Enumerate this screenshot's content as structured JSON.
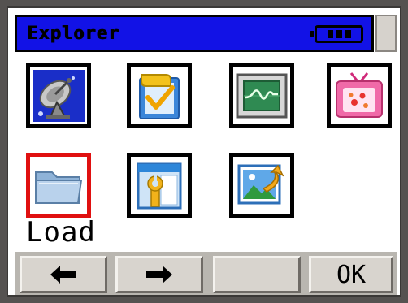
{
  "window": {
    "title": "Explorer"
  },
  "status": {
    "battery_icon": "battery-icon"
  },
  "grid": {
    "items": [
      {
        "icon": "satellite-dish-icon",
        "selected": false
      },
      {
        "icon": "checklist-icon",
        "selected": false
      },
      {
        "icon": "waveform-monitor-icon",
        "selected": false
      },
      {
        "icon": "tv-icon",
        "selected": false
      },
      {
        "icon": "folder-icon",
        "selected": true
      },
      {
        "icon": "settings-window-icon",
        "selected": false
      },
      {
        "icon": "image-arrow-icon",
        "selected": false
      }
    ],
    "selected_label": "Load"
  },
  "softkeys": {
    "back_icon": "arrow-left-icon",
    "forward_icon": "arrow-right-icon",
    "blank": "",
    "ok_label": "OK"
  },
  "colors": {
    "titlebar": "#1212e6",
    "selection": "#e01010",
    "softkey_bar": "#b9b6b0"
  }
}
